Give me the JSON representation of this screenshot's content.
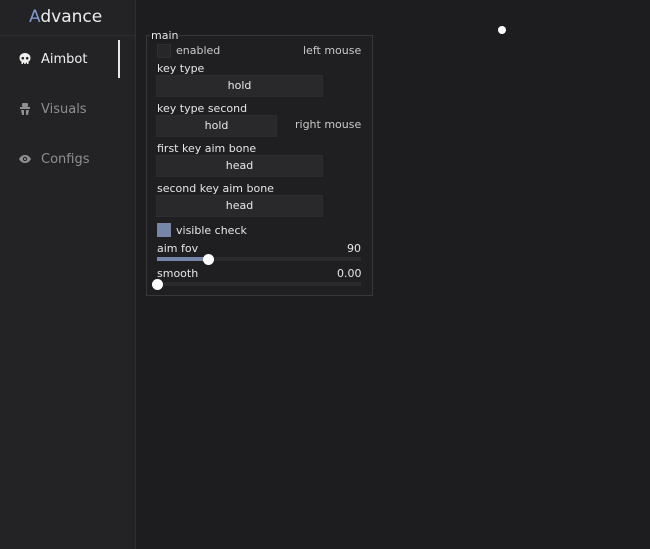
{
  "app": {
    "logo_first": "A",
    "logo_rest": "dvance"
  },
  "sidebar": {
    "items": [
      {
        "label": "Aimbot",
        "icon": "skull-icon",
        "active": true
      },
      {
        "label": "Visuals",
        "icon": "person-icon",
        "active": false
      },
      {
        "label": "Configs",
        "icon": "eye-icon",
        "active": false
      }
    ]
  },
  "main": {
    "title": "main",
    "enabled": {
      "label": "enabled",
      "checked": false,
      "key": "left mouse"
    },
    "key_type": {
      "label": "key type",
      "value": "hold"
    },
    "key_type_second": {
      "label": "key type second",
      "value": "hold",
      "key": "right mouse"
    },
    "first_key_aim_bone": {
      "label": "first key aim bone",
      "value": "head"
    },
    "second_key_aim_bone": {
      "label": "second key aim bone",
      "value": "head"
    },
    "visible_check": {
      "label": "visible check",
      "checked": true
    },
    "aim_fov": {
      "label": "aim fov",
      "value": "90",
      "fill": 0.25
    },
    "smooth": {
      "label": "smooth",
      "value": "0.00",
      "fill": 0.0
    }
  },
  "colors": {
    "accent": "#7686a8",
    "logo_accent": "#7f9ad0",
    "background": "#1d1d1f",
    "sidebar": "#232325"
  }
}
